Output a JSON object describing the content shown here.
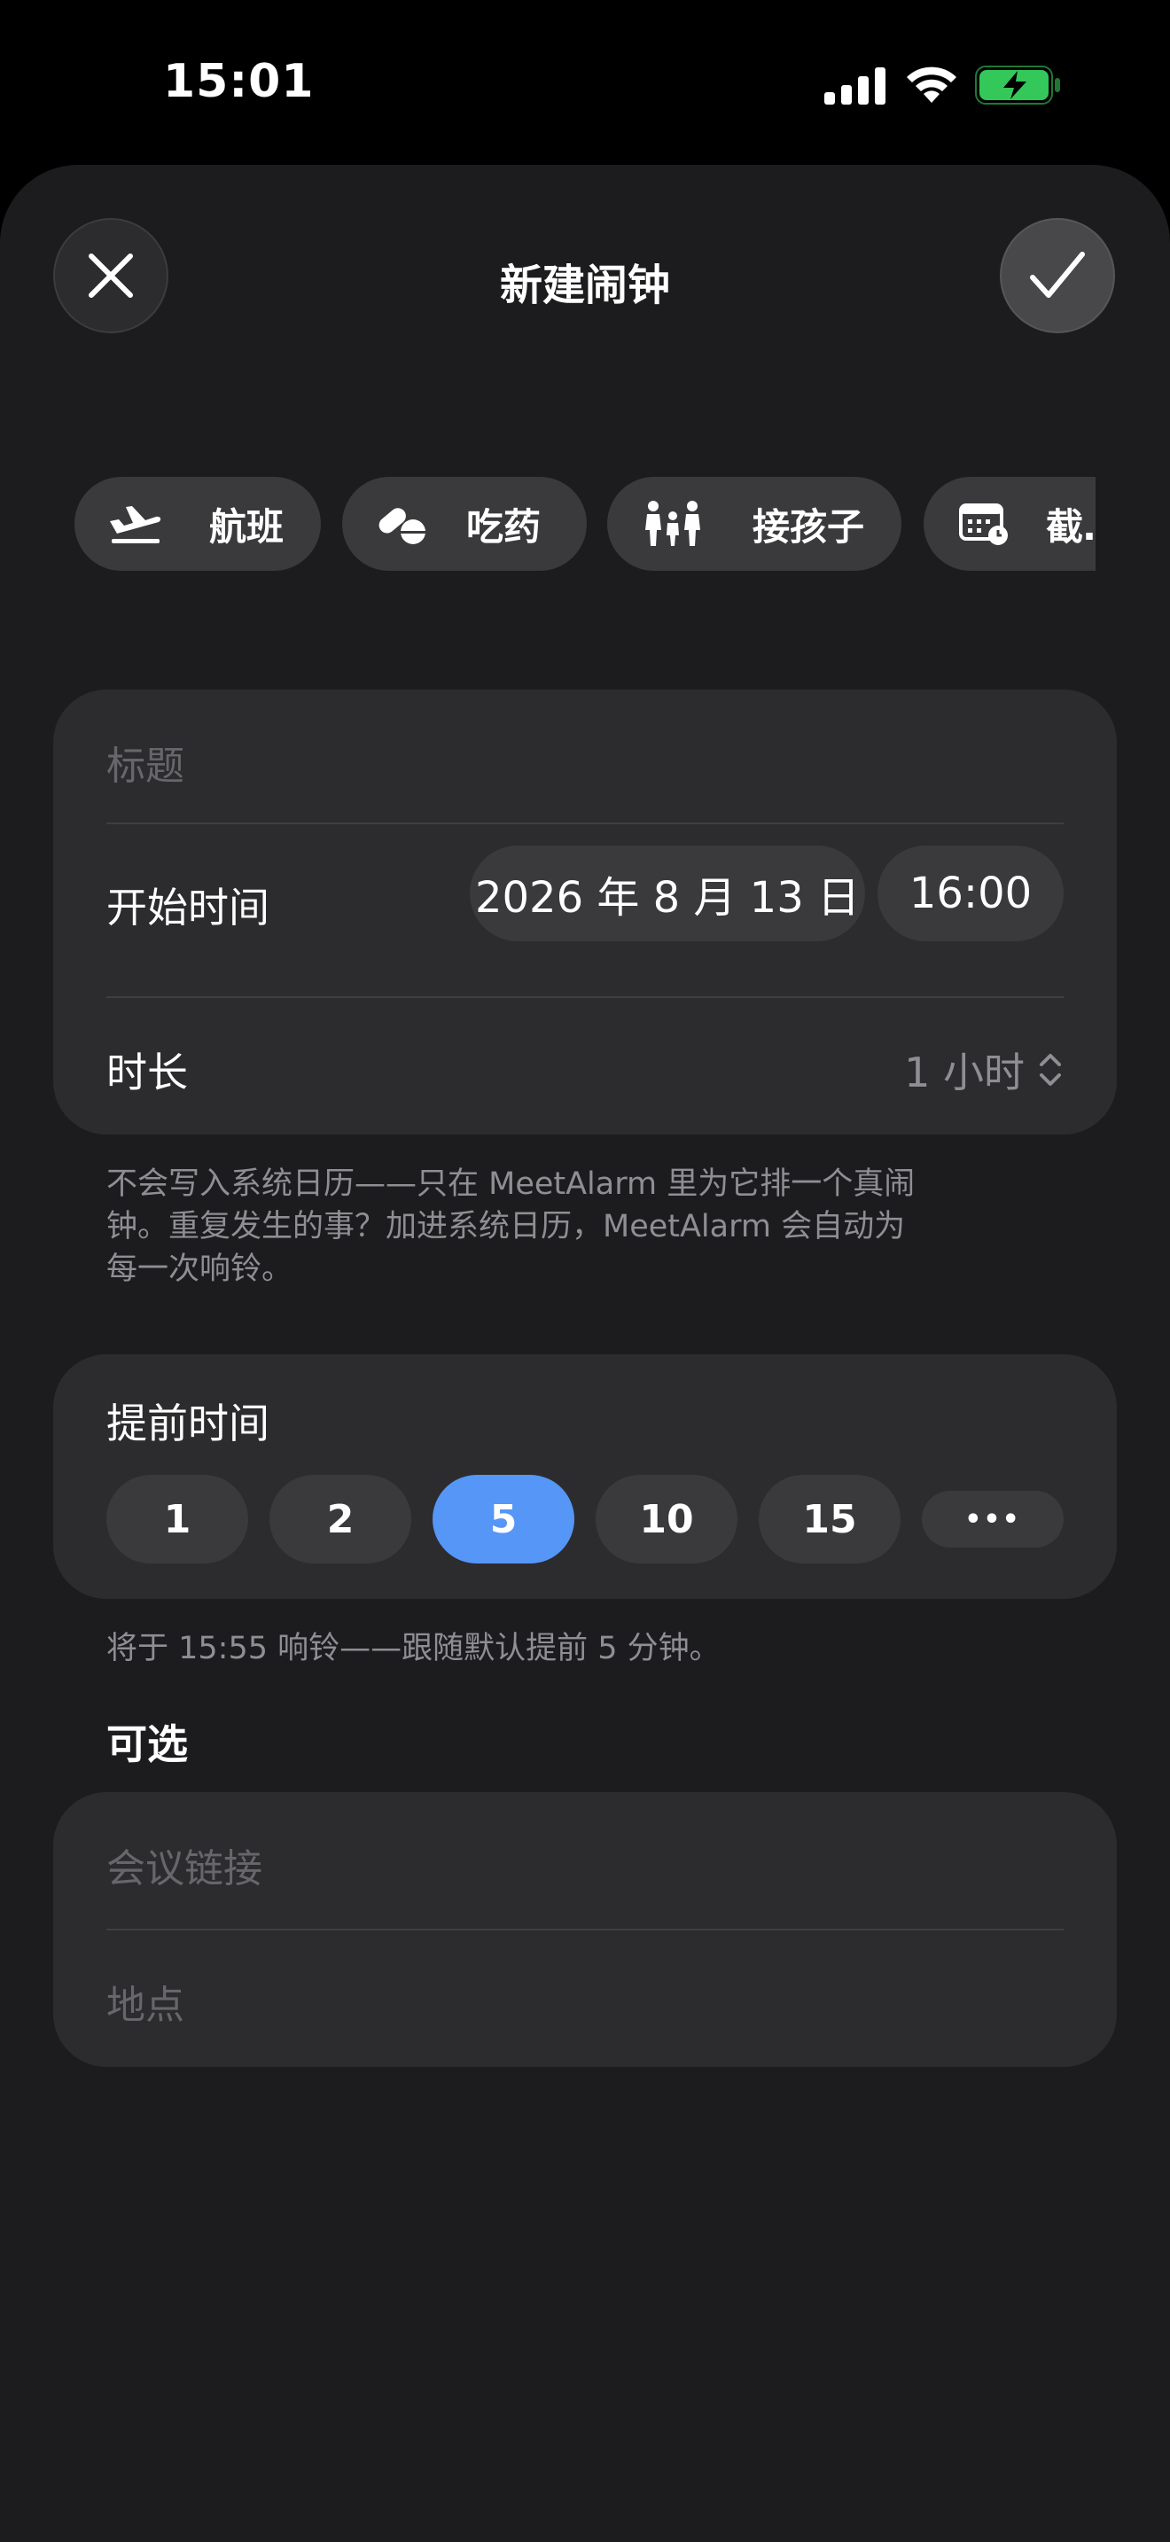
{
  "status_bar": {
    "time": "15:01"
  },
  "sheet": {
    "title": "新建闹钟"
  },
  "templates": [
    {
      "label": "航班",
      "icon": "airplane-departure-icon"
    },
    {
      "label": "吃药",
      "icon": "pills-icon"
    },
    {
      "label": "接孩子",
      "icon": "family-icon"
    },
    {
      "label": "截…",
      "icon": "calendar-clock-icon"
    }
  ],
  "event": {
    "title_placeholder": "标题",
    "start_label": "开始时间",
    "start_date": "2026 年 8 月 13 日",
    "start_time": "16:00",
    "duration_label": "时长",
    "duration_value": "1 小时",
    "note_lines": [
      "不会写入系统日历——只在 MeetAlarm 里为它排一个真闹",
      "钟。重复发生的事？加进系统日历，MeetAlarm 会自动为",
      "每一次响铃。"
    ]
  },
  "lead_time": {
    "label": "提前时间",
    "options": [
      "1",
      "2",
      "5",
      "10",
      "15",
      "•••"
    ],
    "selected_index": 2,
    "note": "将于 15:55 响铃——跟随默认提前 5 分钟。"
  },
  "optional": {
    "label": "可选",
    "meeting_link_placeholder": "会议链接",
    "location_placeholder": "地点"
  },
  "colors": {
    "background": "#000000",
    "sheet": "#1c1c1e",
    "card": "#2c2c2e",
    "chip": "#3a3a3c",
    "accent": "#5596f7",
    "battery_green": "#34c759",
    "secondary_text": "#8e8e93"
  }
}
